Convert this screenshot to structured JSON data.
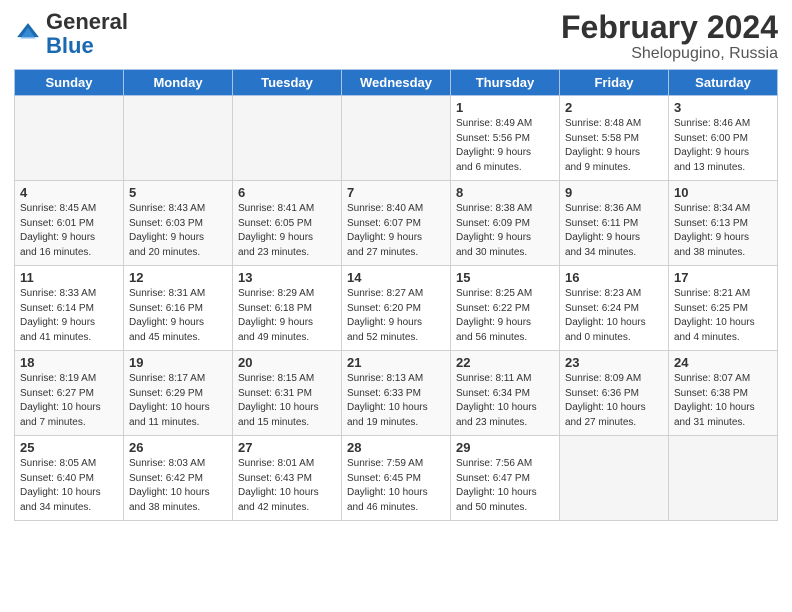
{
  "header": {
    "logo_general": "General",
    "logo_blue": "Blue",
    "month_year": "February 2024",
    "location": "Shelopugino, Russia"
  },
  "weekdays": [
    "Sunday",
    "Monday",
    "Tuesday",
    "Wednesday",
    "Thursday",
    "Friday",
    "Saturday"
  ],
  "weeks": [
    [
      {
        "day": "",
        "info": ""
      },
      {
        "day": "",
        "info": ""
      },
      {
        "day": "",
        "info": ""
      },
      {
        "day": "",
        "info": ""
      },
      {
        "day": "1",
        "info": "Sunrise: 8:49 AM\nSunset: 5:56 PM\nDaylight: 9 hours\nand 6 minutes."
      },
      {
        "day": "2",
        "info": "Sunrise: 8:48 AM\nSunset: 5:58 PM\nDaylight: 9 hours\nand 9 minutes."
      },
      {
        "day": "3",
        "info": "Sunrise: 8:46 AM\nSunset: 6:00 PM\nDaylight: 9 hours\nand 13 minutes."
      }
    ],
    [
      {
        "day": "4",
        "info": "Sunrise: 8:45 AM\nSunset: 6:01 PM\nDaylight: 9 hours\nand 16 minutes."
      },
      {
        "day": "5",
        "info": "Sunrise: 8:43 AM\nSunset: 6:03 PM\nDaylight: 9 hours\nand 20 minutes."
      },
      {
        "day": "6",
        "info": "Sunrise: 8:41 AM\nSunset: 6:05 PM\nDaylight: 9 hours\nand 23 minutes."
      },
      {
        "day": "7",
        "info": "Sunrise: 8:40 AM\nSunset: 6:07 PM\nDaylight: 9 hours\nand 27 minutes."
      },
      {
        "day": "8",
        "info": "Sunrise: 8:38 AM\nSunset: 6:09 PM\nDaylight: 9 hours\nand 30 minutes."
      },
      {
        "day": "9",
        "info": "Sunrise: 8:36 AM\nSunset: 6:11 PM\nDaylight: 9 hours\nand 34 minutes."
      },
      {
        "day": "10",
        "info": "Sunrise: 8:34 AM\nSunset: 6:13 PM\nDaylight: 9 hours\nand 38 minutes."
      }
    ],
    [
      {
        "day": "11",
        "info": "Sunrise: 8:33 AM\nSunset: 6:14 PM\nDaylight: 9 hours\nand 41 minutes."
      },
      {
        "day": "12",
        "info": "Sunrise: 8:31 AM\nSunset: 6:16 PM\nDaylight: 9 hours\nand 45 minutes."
      },
      {
        "day": "13",
        "info": "Sunrise: 8:29 AM\nSunset: 6:18 PM\nDaylight: 9 hours\nand 49 minutes."
      },
      {
        "day": "14",
        "info": "Sunrise: 8:27 AM\nSunset: 6:20 PM\nDaylight: 9 hours\nand 52 minutes."
      },
      {
        "day": "15",
        "info": "Sunrise: 8:25 AM\nSunset: 6:22 PM\nDaylight: 9 hours\nand 56 minutes."
      },
      {
        "day": "16",
        "info": "Sunrise: 8:23 AM\nSunset: 6:24 PM\nDaylight: 10 hours\nand 0 minutes."
      },
      {
        "day": "17",
        "info": "Sunrise: 8:21 AM\nSunset: 6:25 PM\nDaylight: 10 hours\nand 4 minutes."
      }
    ],
    [
      {
        "day": "18",
        "info": "Sunrise: 8:19 AM\nSunset: 6:27 PM\nDaylight: 10 hours\nand 7 minutes."
      },
      {
        "day": "19",
        "info": "Sunrise: 8:17 AM\nSunset: 6:29 PM\nDaylight: 10 hours\nand 11 minutes."
      },
      {
        "day": "20",
        "info": "Sunrise: 8:15 AM\nSunset: 6:31 PM\nDaylight: 10 hours\nand 15 minutes."
      },
      {
        "day": "21",
        "info": "Sunrise: 8:13 AM\nSunset: 6:33 PM\nDaylight: 10 hours\nand 19 minutes."
      },
      {
        "day": "22",
        "info": "Sunrise: 8:11 AM\nSunset: 6:34 PM\nDaylight: 10 hours\nand 23 minutes."
      },
      {
        "day": "23",
        "info": "Sunrise: 8:09 AM\nSunset: 6:36 PM\nDaylight: 10 hours\nand 27 minutes."
      },
      {
        "day": "24",
        "info": "Sunrise: 8:07 AM\nSunset: 6:38 PM\nDaylight: 10 hours\nand 31 minutes."
      }
    ],
    [
      {
        "day": "25",
        "info": "Sunrise: 8:05 AM\nSunset: 6:40 PM\nDaylight: 10 hours\nand 34 minutes."
      },
      {
        "day": "26",
        "info": "Sunrise: 8:03 AM\nSunset: 6:42 PM\nDaylight: 10 hours\nand 38 minutes."
      },
      {
        "day": "27",
        "info": "Sunrise: 8:01 AM\nSunset: 6:43 PM\nDaylight: 10 hours\nand 42 minutes."
      },
      {
        "day": "28",
        "info": "Sunrise: 7:59 AM\nSunset: 6:45 PM\nDaylight: 10 hours\nand 46 minutes."
      },
      {
        "day": "29",
        "info": "Sunrise: 7:56 AM\nSunset: 6:47 PM\nDaylight: 10 hours\nand 50 minutes."
      },
      {
        "day": "",
        "info": ""
      },
      {
        "day": "",
        "info": ""
      }
    ]
  ]
}
